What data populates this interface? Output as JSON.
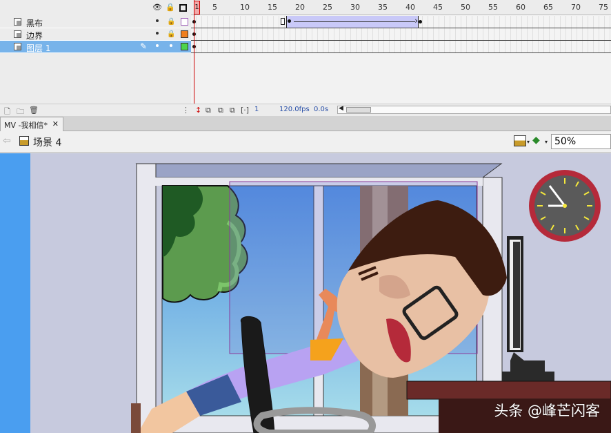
{
  "timeline": {
    "header_icons": [
      "eye-icon",
      "lock-icon",
      "outline-icon"
    ],
    "layers": [
      {
        "name": "黑布",
        "color": "#ffffff",
        "outline": "#9b59b6"
      },
      {
        "name": "边界",
        "color": "#f07f1e",
        "outline": "#333333"
      },
      {
        "name": "图层 1",
        "color": "#4cd44c",
        "outline": "#333333",
        "selected": true
      }
    ],
    "frame_numbers": [
      "1",
      "5",
      "10",
      "15",
      "20",
      "25",
      "30",
      "35",
      "40",
      "45",
      "50",
      "55",
      "60",
      "65",
      "70",
      "75"
    ],
    "current_frame": "1",
    "footer": {
      "frame": "1",
      "fps": "120.0",
      "fps_unit": "fps",
      "time": "0.0",
      "time_unit": "s"
    }
  },
  "document": {
    "tab_title": "MV -我相信*",
    "close_glyph": "✕"
  },
  "editbar": {
    "scene_label": "场景 4",
    "zoom": "50%"
  },
  "watermark": "头条 @峰芒闪客"
}
